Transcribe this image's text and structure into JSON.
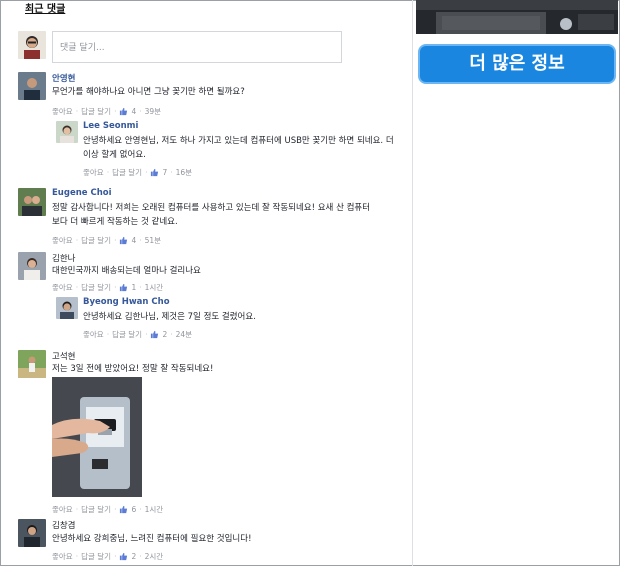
{
  "section": {
    "title": "최근 댓글"
  },
  "compose": {
    "placeholder": "댓글 달기..."
  },
  "actions": {
    "like": "좋아요",
    "reply": "답글 달기"
  },
  "comments": [
    {
      "name": "안영현",
      "text": "무언가를 해야하나요 아니면 그냥 꽂기만 하면 될까요?",
      "likes": "4",
      "time": "39분"
    },
    {
      "name": "Lee Seonmi",
      "text": "안녕하세요 안영현님, 저도 하나 가지고 있는데 컴퓨터에 USB만 꽂기만 하면 되네요. 더 이상 할게 없어요.",
      "likes": "7",
      "time": "16분"
    },
    {
      "name": "Eugene Choi",
      "text": "정말 감사합니다! 저희는 오래된 컴퓨터를 사용하고 있는데 잘 작동되네요! 요새 산 컴퓨터보다 더 빠르게 작동하는 것 같네요.",
      "likes": "4",
      "time": "51분"
    },
    {
      "name": "김한나",
      "text": "대한민국까지 배송되는데 얼마나 걸리나요",
      "likes": "1",
      "time": "1시간"
    },
    {
      "name": "Byeong Hwan Cho",
      "text": "안녕하세요 김한나님, 제것은 7일 정도 걸렸어요.",
      "likes": "2",
      "time": "24분"
    },
    {
      "name": "고석현",
      "text": "저는 3일 전에 받았어요! 정말 잘 작동되네요!",
      "likes": "6",
      "time": "1시간"
    },
    {
      "name": "김창겸",
      "text": "안녕하세요 강희중님, 느려진 컴퓨터에 필요한 것입니다!",
      "likes": "2",
      "time": "2시간"
    }
  ],
  "sidebar": {
    "more_info": "더 많은 정보"
  }
}
